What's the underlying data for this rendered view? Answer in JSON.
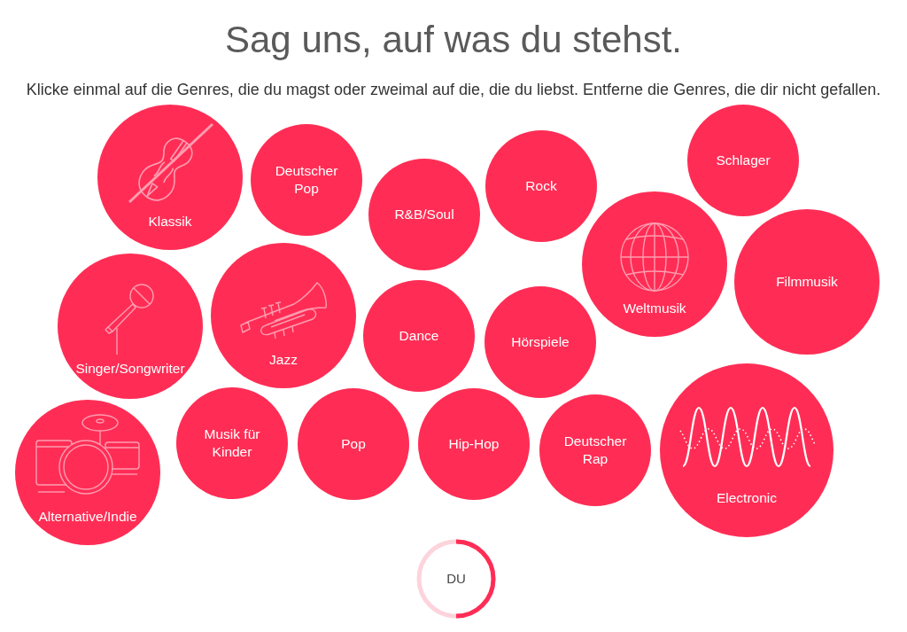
{
  "heading": "Sag uns, auf was du stehst.",
  "instructions": "Klicke einmal auf die Genres, die du magst oder zweimal auf die, die du liebst. Entferne die Genres, die dir nicht gefallen.",
  "genres": [
    {
      "label": "Klassik",
      "kind": "icon"
    },
    {
      "label": "Deutscher Pop",
      "kind": "text"
    },
    {
      "label": "R&B/Soul",
      "kind": "text"
    },
    {
      "label": "Rock",
      "kind": "text"
    },
    {
      "label": "Schlager",
      "kind": "text"
    },
    {
      "label": "Weltmusik",
      "kind": "icon"
    },
    {
      "label": "Filmmusik",
      "kind": "text"
    },
    {
      "label": "Singer/Songwriter",
      "kind": "icon"
    },
    {
      "label": "Jazz",
      "kind": "icon"
    },
    {
      "label": "Dance",
      "kind": "text"
    },
    {
      "label": "Hörspiele",
      "kind": "text"
    },
    {
      "label": "Alternative/Indie",
      "kind": "icon"
    },
    {
      "label": "Musik für Kinder",
      "kind": "text"
    },
    {
      "label": "Pop",
      "kind": "text"
    },
    {
      "label": "Hip-Hop",
      "kind": "text"
    },
    {
      "label": "Deutscher Rap",
      "kind": "text"
    },
    {
      "label": "Electronic",
      "kind": "icon"
    }
  ],
  "profile": {
    "label": "DU",
    "level": 0.5
  }
}
